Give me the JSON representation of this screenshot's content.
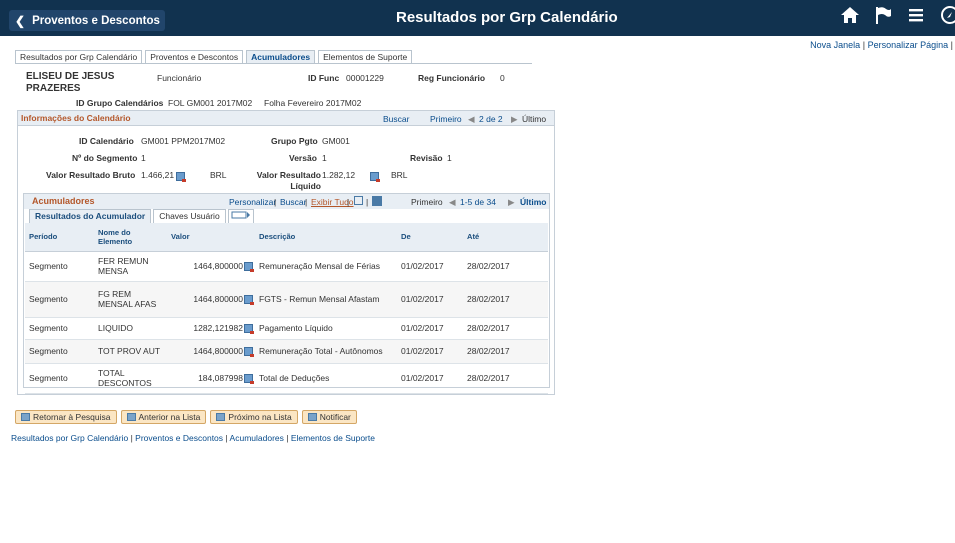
{
  "header": {
    "back_label": "Proventos e Descontos",
    "title": "Resultados por Grp Calendário"
  },
  "top_links": {
    "new_window": "Nova Janela",
    "sep": "|",
    "personalize": "Personalizar Página",
    "sep2": "|"
  },
  "tabs": [
    "Resultados por Grp Calendário",
    "Proventos e Descontos",
    "Acumuladores",
    "Elementos de Suporte"
  ],
  "employee": {
    "name": "ELISEU DE JESUS PRAZERES",
    "role": "Funcionário",
    "id_label": "ID Func",
    "id": "00001229",
    "reg_label": "Reg Funcionário",
    "reg": "0",
    "grp_label": "ID Grupo Calendários",
    "grp": "FOL GM001 2017M02",
    "grp_desc": "Folha Fevereiro 2017M02"
  },
  "calendar": {
    "title": "Informações do Calendário",
    "search": "Buscar",
    "first": "Primeiro",
    "pager": "2 de 2",
    "last": "Último",
    "id_cal_label": "ID Calendário",
    "id_cal": "GM001 PPM2017M02",
    "grupo_label": "Grupo Pgto",
    "grupo": "GM001",
    "seg_label": "Nº do Segmento",
    "seg": "1",
    "versao_label": "Versão",
    "versao": "1",
    "revisao_label": "Revisão",
    "revisao": "1",
    "bruto_label": "Valor Resultado Bruto",
    "bruto": "1.466,21",
    "bruto_cur": "BRL",
    "liq_label": "Valor Resultado Líquido",
    "liq": "1.282,12",
    "liq_cur": "BRL"
  },
  "acum": {
    "title": "Acumuladores",
    "personalize": "Personalizar",
    "search": "Buscar",
    "show_all": "Exibir Tudo",
    "sep": "|",
    "first": "Primeiro",
    "pager": "1-5 de 34",
    "last": "Último",
    "subtabs": [
      "Resultados do Acumulador",
      "Chaves Usuário"
    ],
    "columns": [
      "Período",
      "Nome do Elemento",
      "Valor",
      "Descrição",
      "De",
      "Até"
    ],
    "rows": [
      {
        "periodo": "Segmento",
        "nome": "FER REMUN MENSA",
        "valor": "1464,800000",
        "desc": "Remuneração Mensal de Férias",
        "de": "01/02/2017",
        "ate": "28/02/2017"
      },
      {
        "periodo": "Segmento",
        "nome": "FG REM MENSAL AFAS",
        "valor": "1464,800000",
        "desc": "FGTS - Remun Mensal Afastam",
        "de": "01/02/2017",
        "ate": "28/02/2017"
      },
      {
        "periodo": "Segmento",
        "nome": "LIQUIDO",
        "valor": "1282,121982",
        "desc": "Pagamento Líquido",
        "de": "01/02/2017",
        "ate": "28/02/2017"
      },
      {
        "periodo": "Segmento",
        "nome": "TOT PROV AUT",
        "valor": "1464,800000",
        "desc": "Remuneração Total - Autônomos",
        "de": "01/02/2017",
        "ate": "28/02/2017"
      },
      {
        "periodo": "Segmento",
        "nome": "TOTAL DESCONTOS",
        "valor": "184,087998",
        "desc": "Total de Deduções",
        "de": "01/02/2017",
        "ate": "28/02/2017"
      }
    ]
  },
  "buttons": [
    "Retornar à Pesquisa",
    "Anterior na Lista",
    "Próximo na Lista",
    "Notificar"
  ],
  "footer": [
    "Resultados por Grp Calendário",
    "Proventos e Descontos",
    "Acumuladores",
    "Elementos de Suporte"
  ],
  "footer_sep": "|",
  "colors": {
    "header_bg": "#11324f",
    "accent": "#0a4d8c",
    "section_title": "#b4572a"
  }
}
